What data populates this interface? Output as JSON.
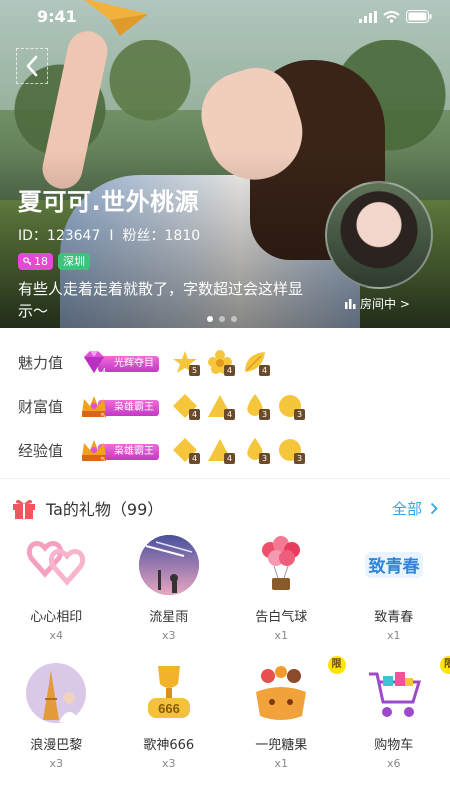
{
  "status_bar": {
    "time": "9:41"
  },
  "profile": {
    "name": "夏可可.世外桃源",
    "id_text": "ID：123647",
    "separator": "I",
    "fans_text": "粉丝：1810",
    "level_tag": "18",
    "city_tag": "深圳",
    "bio": "有些人走着走着就散了，字数超过会这样显示～",
    "room_label": "房间中 >"
  },
  "carousel": {
    "pages": 3,
    "active": 0
  },
  "stats": [
    {
      "label": "魅力值",
      "badge": "光辉夺目",
      "badge_level": "4",
      "levels": [
        {
          "icon": "star-icon",
          "num": "5"
        },
        {
          "icon": "flower-icon",
          "num": "4"
        },
        {
          "icon": "leaf-icon",
          "num": "4"
        }
      ]
    },
    {
      "label": "财富值",
      "badge": "枭雄霸王",
      "badge_level": "5",
      "levels": [
        {
          "icon": "diamond-icon",
          "num": "4"
        },
        {
          "icon": "triangle-icon",
          "num": "4"
        },
        {
          "icon": "drop-icon",
          "num": "3"
        },
        {
          "icon": "circle-icon",
          "num": "3"
        }
      ]
    },
    {
      "label": "经验值",
      "badge": "枭雄霸王",
      "badge_level": "5",
      "levels": [
        {
          "icon": "diamond-icon",
          "num": "4"
        },
        {
          "icon": "triangle-icon",
          "num": "4"
        },
        {
          "icon": "drop-icon",
          "num": "3"
        },
        {
          "icon": "circle-icon",
          "num": "3"
        }
      ]
    }
  ],
  "gifts": {
    "title": "Ta的礼物（99）",
    "all_label": "全部",
    "items": [
      {
        "name": "心心相印",
        "count": "x4",
        "icon": "hearts-icon"
      },
      {
        "name": "流星雨",
        "count": "x3",
        "icon": "meteor-icon"
      },
      {
        "name": "告白气球",
        "count": "x1",
        "icon": "balloon-icon"
      },
      {
        "name": "致青春",
        "count": "x1",
        "icon": "youth-icon"
      },
      {
        "name": "浪漫巴黎",
        "count": "x3",
        "icon": "paris-icon"
      },
      {
        "name": "歌神666",
        "count": "x3",
        "icon": "trophy-666-icon"
      },
      {
        "name": "一兜糖果",
        "count": "x1",
        "icon": "candy-icon",
        "limited": "限"
      },
      {
        "name": "购物车",
        "count": "x6",
        "icon": "cart-icon",
        "limited": "限"
      }
    ]
  },
  "colors": {
    "accent_blue": "#39a2e8",
    "tag_pink": "#e24bd2",
    "tag_green": "#3cc47e",
    "badge_purple": "#c238c4",
    "level_gold": "#f5c63b"
  }
}
